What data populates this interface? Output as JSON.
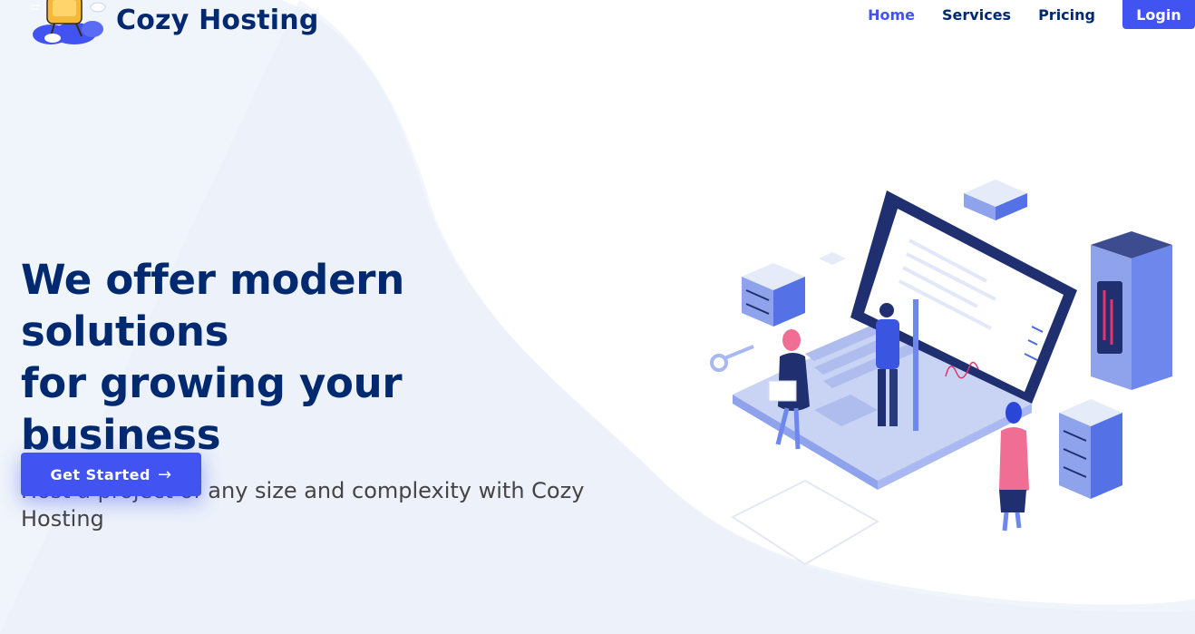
{
  "brand": {
    "name": "Cozy Hosting",
    "logo_icon": "armchair-on-cloud-icon"
  },
  "nav": {
    "items": [
      {
        "label": "Home",
        "active": true
      },
      {
        "label": "Services",
        "active": false
      },
      {
        "label": "Pricing",
        "active": false
      }
    ],
    "login_label": "Login"
  },
  "hero": {
    "title_line1": "We offer modern solutions",
    "title_line2": "for growing your business",
    "subtitle": "Host a project of any size and complexity with Cozy Hosting",
    "cta_label": "Get Started",
    "cta_icon": "arrow-right-icon",
    "illustration": "laptop-servers-people-icon"
  },
  "colors": {
    "primary": "#4154f1",
    "heading": "#012970",
    "text": "#444444",
    "background_wave": "#f0f4fb"
  }
}
